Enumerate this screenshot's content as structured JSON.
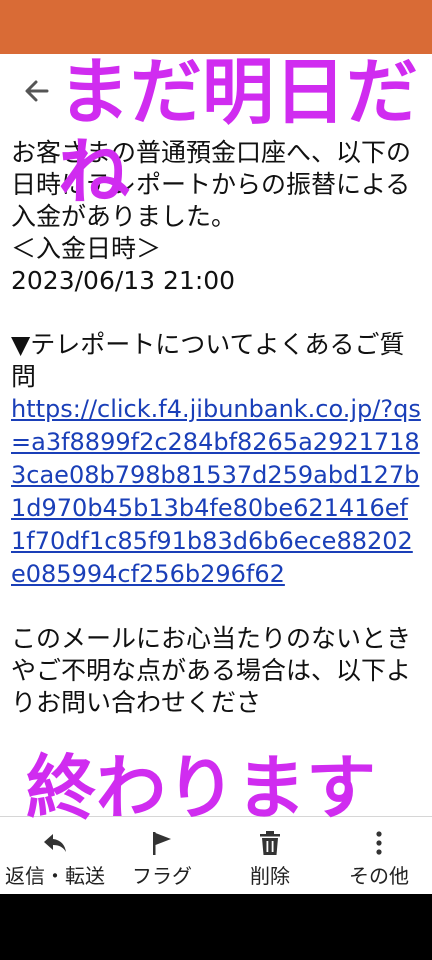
{
  "overlay": {
    "top_caption": "まだ明日だね",
    "bottom_caption": "終わります"
  },
  "message": {
    "line1": "お客さまの普通預金口座へ、以下の日時にテレポートからの振替による入金がありました。",
    "deposit_heading": "＜入金日時＞",
    "deposit_datetime": "2023/06/13 21:00",
    "faq_heading": "▼テレポートについてよくあるご質問",
    "faq_link": "https://click.f4.jibunbank.co.jp/?qs=a3f8899f2c284bf8265a29217183cae08b798b81537d259abd127b1d970b45b13b4fe80be621416ef1f70df1c85f91b83d6b6ece88202e085994cf256b296f62",
    "closing_text": "このメールにお心当たりのないときやご不明な点がある場合は、以下よりお問い合わせくださ"
  },
  "toolbar": {
    "reply_label": "返信・転送",
    "flag_label": "フラグ",
    "delete_label": "削除",
    "more_label": "その他"
  },
  "icons": {
    "back": "back-arrow-icon",
    "reply": "reply-icon",
    "flag": "flag-icon",
    "delete": "trash-icon",
    "more": "more-vertical-icon"
  },
  "colors": {
    "status_bar": "#D96B36",
    "overlay_text": "#D02CF0",
    "link": "#1a3fb8"
  }
}
